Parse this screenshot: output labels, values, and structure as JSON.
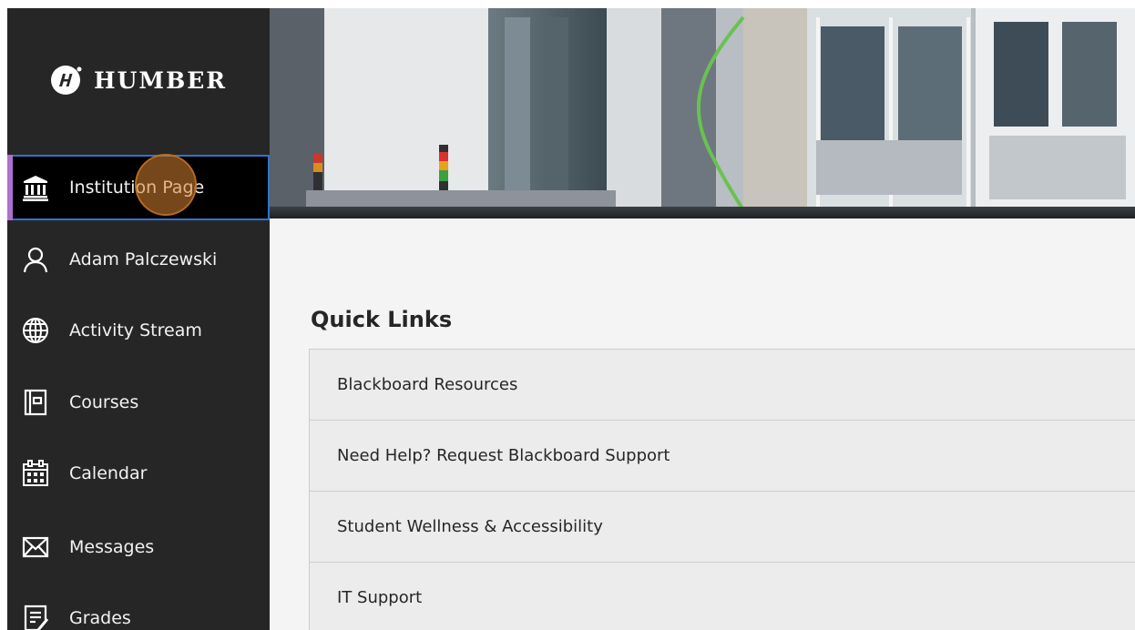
{
  "sidebar": {
    "logo_text": "HUMBER",
    "items": [
      {
        "label": "Institution Page",
        "icon": "institution-icon",
        "active": true
      },
      {
        "label": "Adam Palczewski",
        "icon": "user-icon"
      },
      {
        "label": "Activity Stream",
        "icon": "globe-icon"
      },
      {
        "label": "Courses",
        "icon": "courses-icon"
      },
      {
        "label": "Calendar",
        "icon": "calendar-icon"
      },
      {
        "label": "Messages",
        "icon": "envelope-icon"
      },
      {
        "label": "Grades",
        "icon": "grades-icon"
      }
    ]
  },
  "main": {
    "quick_links_heading": "Quick Links",
    "quick_links": [
      "Blackboard Resources",
      "Need Help? Request Blackboard Support",
      "Student Wellness & Accessibility",
      "IT Support"
    ]
  },
  "colors": {
    "sidebar_bg": "#262626",
    "active_outline": "#2f74d0",
    "active_marker": "#b06fd0"
  }
}
